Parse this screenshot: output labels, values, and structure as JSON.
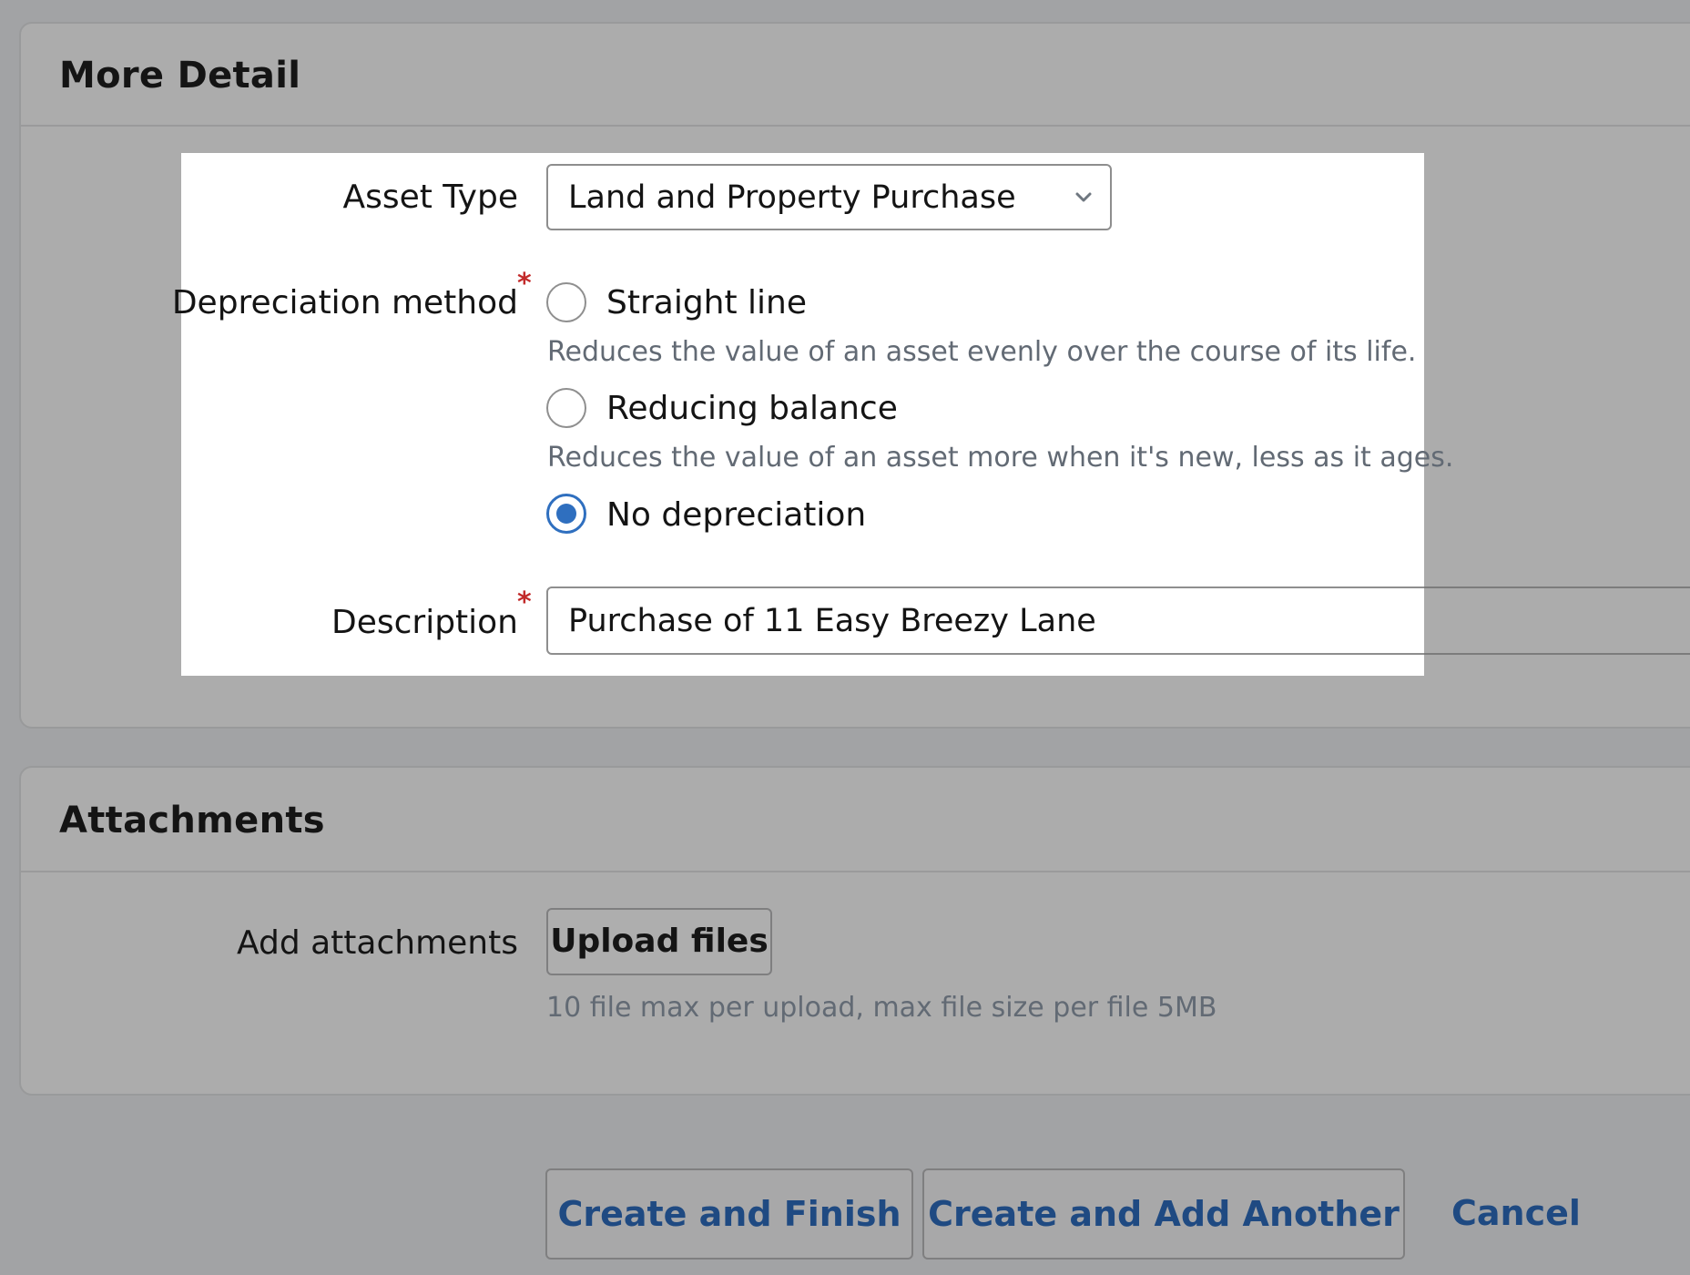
{
  "more_detail": {
    "title": "More Detail",
    "asset_type": {
      "label": "Asset Type",
      "selected": "Land and Property Purchase"
    },
    "depreciation": {
      "label": "Depreciation method",
      "required_mark": "*",
      "options": [
        {
          "label": "Straight line",
          "help": "Reduces the value of an asset evenly over the course of its life.",
          "checked": false
        },
        {
          "label": "Reducing balance",
          "help": "Reduces the value of an asset more when it's new, less as it ages.",
          "checked": false
        },
        {
          "label": "No depreciation",
          "help": "",
          "checked": true
        }
      ]
    },
    "description": {
      "label": "Description",
      "required_mark": "*",
      "value": "Purchase of 11 Easy Breezy Lane"
    }
  },
  "attachments": {
    "title": "Attachments",
    "label": "Add attachments",
    "upload_label": "Upload files",
    "help": "10 file max per upload, max file size per file 5MB"
  },
  "actions": {
    "create_finish": "Create and Finish",
    "create_another": "Create and Add Another",
    "cancel": "Cancel"
  },
  "colors": {
    "accent": "#2f6fbf",
    "link": "#1f4a82",
    "required": "#c22a2a"
  }
}
